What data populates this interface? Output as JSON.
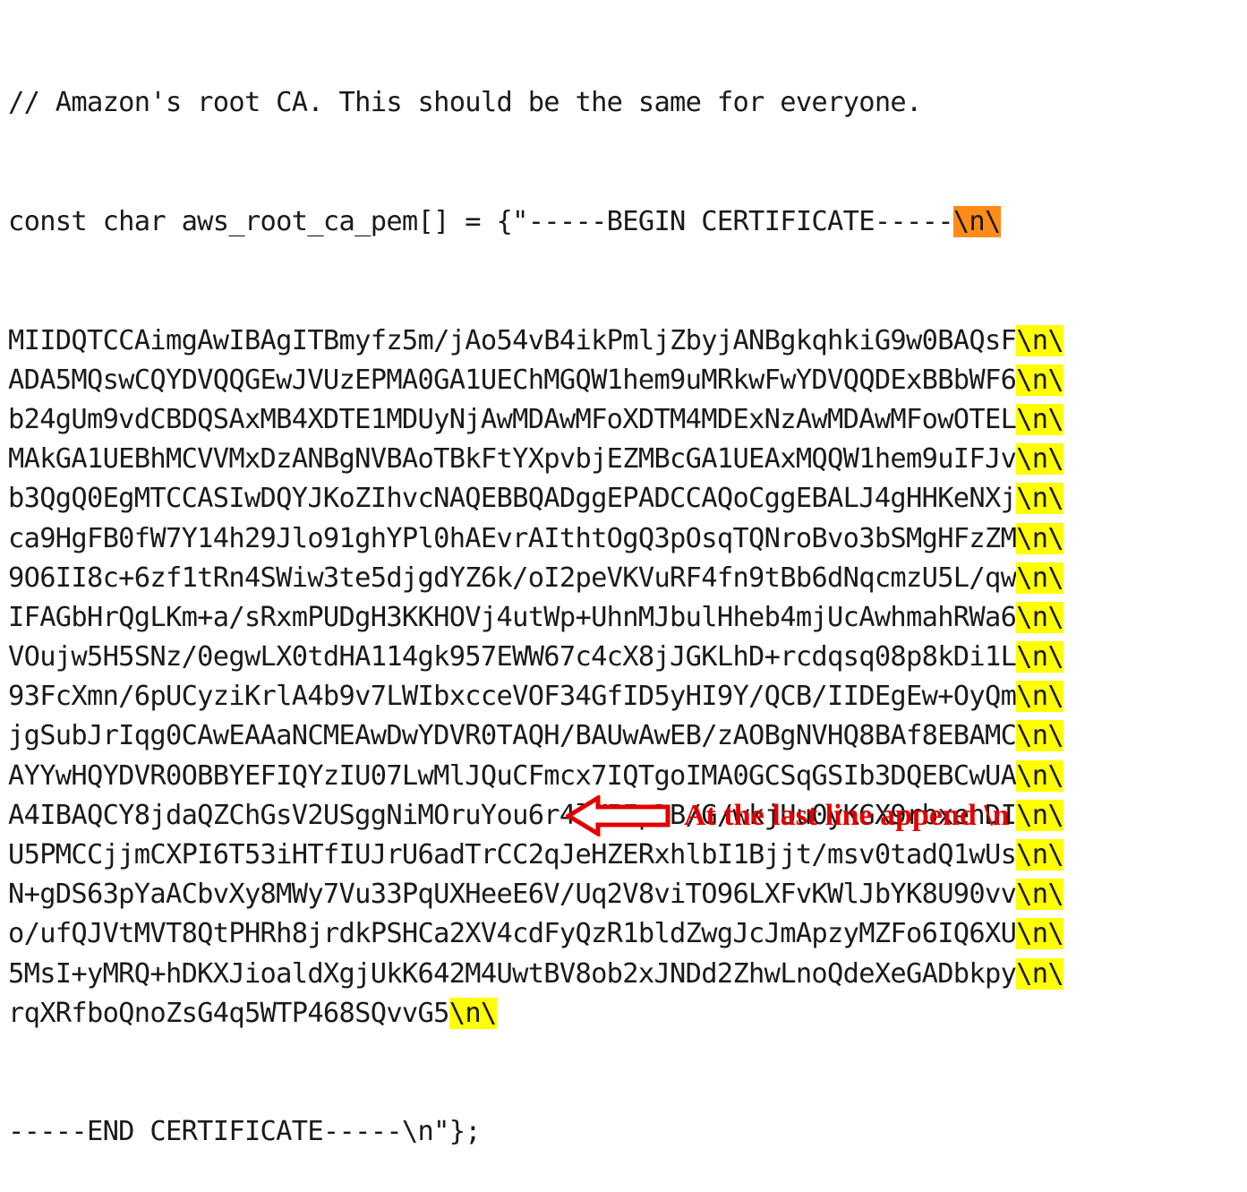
{
  "code": {
    "comment": "// Amazon's root CA. This should be the same for everyone.",
    "declaration": "const char aws_root_ca_pem[] = {\"-----BEGIN CERTIFICATE-----",
    "declaration_suffix": "\\n\\",
    "lines": [
      {
        "text": "MIIDQTCCAimgAwIBAgITBmyfz5m/jAo54vB4ikPmljZbyjANBgkqhkiG9w0BAQsF",
        "suffix": "\\n\\"
      },
      {
        "text": "ADA5MQswCQYDVQQGEwJVUzEPMA0GA1UEChMGQW1hem9uMRkwFwYDVQQDExBBbWF6",
        "suffix": "\\n\\"
      },
      {
        "text": "b24gUm9vdCBDQSAxMB4XDTE1MDUyNjAwMDAwMFoXDTM4MDExNzAwMDAwMFowOTEL",
        "suffix": "\\n\\"
      },
      {
        "text": "MAkGA1UEBhMCVVMxDzANBgNVBAoTBkFtYXpvbjEZMBcGA1UEAxMQQW1hem9uIFJv",
        "suffix": "\\n\\"
      },
      {
        "text": "b3QgQ0EgMTCCASIwDQYJKoZIhvcNAQEBBQADggEPADCCAQoCggEBALJ4gHHKeNXj",
        "suffix": "\\n\\"
      },
      {
        "text": "ca9HgFB0fW7Y14h29Jlo91ghYPl0hAEvrAIthtOgQ3pOsqTQNroBvo3bSMgHFzZM",
        "suffix": "\\n\\"
      },
      {
        "text": "9O6II8c+6zf1tRn4SWiw3te5djgdYZ6k/oI2peVKVuRF4fn9tBb6dNqcmzU5L/qw",
        "suffix": "\\n\\"
      },
      {
        "text": "IFAGbHrQgLKm+a/sRxmPUDgH3KKHOVj4utWp+UhnMJbulHheb4mjUcAwhmahRWa6",
        "suffix": "\\n\\"
      },
      {
        "text": "VOujw5H5SNz/0egwLX0tdHA114gk957EWW67c4cX8jJGKLhD+rcdqsq08p8kDi1L",
        "suffix": "\\n\\"
      },
      {
        "text": "93FcXmn/6pUCyziKrlA4b9v7LWIbxcceVOF34GfID5yHI9Y/QCB/IIDEgEw+OyQm",
        "suffix": "\\n\\"
      },
      {
        "text": "jgSubJrIqg0CAwEAAaNCMEAwDwYDVR0TAQH/BAUwAwEB/zAOBgNVHQ8BAf8EBAMC",
        "suffix": "\\n\\"
      },
      {
        "text": "AYYwHQYDVR0OBBYEFIQYzIU07LwMlJQuCFmcx7IQTgoIMA0GCSqGSIb3DQEBCwUA",
        "suffix": "\\n\\"
      },
      {
        "text": "A4IBAQCY8jdaQZChGsV2USggNiMOruYou6r4lK5IpDB/G/wkjUu0yKGX9rbxenDI",
        "suffix": "\\n\\"
      },
      {
        "text": "U5PMCCjjmCXPI6T53iHTfIUJrU6adTrCC2qJeHZERxhlbI1Bjjt/msv0tadQ1wUs",
        "suffix": "\\n\\"
      },
      {
        "text": "N+gDS63pYaACbvXy8MWy7Vu33PqUXHeeE6V/Uq2V8viTO96LXFvKWlJbYK8U90vv",
        "suffix": "\\n\\"
      },
      {
        "text": "o/ufQJVtMVT8QtPHRh8jrdkPSHCa2XV4cdFyQzR1bldZwgJcJmApzyMZFo6IQ6XU",
        "suffix": "\\n\\"
      },
      {
        "text": "5MsI+yMRQ+hDKXJioaldXgjUkK642M4UwtBV8ob2xJNDd2ZhwLnoQdeXeGADbkpy",
        "suffix": "\\n\\"
      },
      {
        "text": "rqXRfboQnoZsG4q5WTP468SQvvG5",
        "suffix": "\\n\\"
      }
    ],
    "end_line": "-----END CERTIFICATE-----\\n\"};"
  },
  "annotation": {
    "text": "At the last line append \\n",
    "icon": "left-arrow-icon",
    "color": "#e00000"
  },
  "colors": {
    "highlight_yellow": "#ffff00",
    "highlight_orange": "#ff8c1a",
    "code_text": "#1a1a1a"
  }
}
